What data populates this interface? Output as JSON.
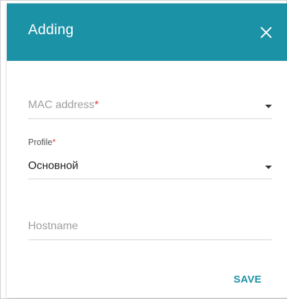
{
  "dialog": {
    "title": "Adding",
    "close_icon": "close-icon"
  },
  "fields": {
    "mac": {
      "placeholder": "MAC address",
      "required_mark": "*"
    },
    "profile": {
      "label": "Profile",
      "required_mark": "*",
      "value": "Основной"
    },
    "hostname": {
      "placeholder": "Hostname"
    }
  },
  "actions": {
    "save_label": "SAVE"
  },
  "colors": {
    "accent": "#1c92a6",
    "required": "#e53935"
  }
}
